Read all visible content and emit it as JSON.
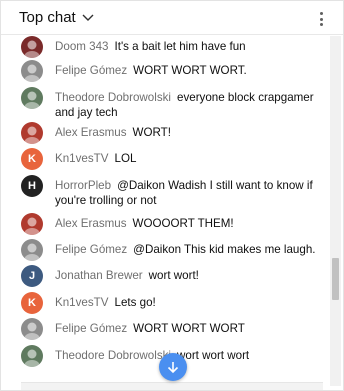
{
  "header": {
    "title": "Top chat",
    "menu_icon": "more-vert-icon",
    "chevron_icon": "chevron-down-icon"
  },
  "messages": [
    {
      "author": "Doom 343",
      "text": "It's a bait let him have fun",
      "avatar": {
        "kind": "photo",
        "color": "#7a2a2a"
      }
    },
    {
      "author": "Felipe Gómez",
      "text": "WORT WORT WORT.",
      "avatar": {
        "kind": "photo",
        "color": "#8c8c8c"
      }
    },
    {
      "author": "Theodore Dobrowolski",
      "text": "everyone block crapgamer and jay tech",
      "avatar": {
        "kind": "photo",
        "color": "#5f7a5f"
      }
    },
    {
      "author": "Alex Erasmus",
      "text": "WORT!",
      "avatar": {
        "kind": "photo",
        "color": "#b03a2e"
      }
    },
    {
      "author": "Kn1vesTV",
      "text": "LOL",
      "avatar": {
        "kind": "letter",
        "letter": "K",
        "color": "#e8643c"
      }
    },
    {
      "author": "HorrorPleb",
      "text": "@Daikon Wadish I still want to know if you're trolling or not",
      "avatar": {
        "kind": "letter",
        "letter": "H",
        "color": "#222222"
      }
    },
    {
      "author": "Alex Erasmus",
      "text": "WOOOORT THEM!",
      "avatar": {
        "kind": "photo",
        "color": "#b03a2e"
      }
    },
    {
      "author": "Felipe Gómez",
      "text": "@Daikon This kid makes me laugh.",
      "avatar": {
        "kind": "photo",
        "color": "#8c8c8c"
      }
    },
    {
      "author": "Jonathan Brewer",
      "text": "wort wort!",
      "avatar": {
        "kind": "letter",
        "letter": "J",
        "color": "#3d5a80"
      }
    },
    {
      "author": "Kn1vesTV",
      "text": "Lets go!",
      "avatar": {
        "kind": "letter",
        "letter": "K",
        "color": "#e8643c"
      }
    },
    {
      "author": "Felipe Gómez",
      "text": "WORT WORT WORT",
      "avatar": {
        "kind": "photo",
        "color": "#8c8c8c"
      }
    },
    {
      "author": "Theodore Dobrowolski",
      "text": "wort wort wort",
      "avatar": {
        "kind": "photo",
        "color": "#5f7a5f"
      }
    }
  ],
  "scroll_button": {
    "icon": "arrow-down-icon",
    "color": "#4a8ff0"
  }
}
